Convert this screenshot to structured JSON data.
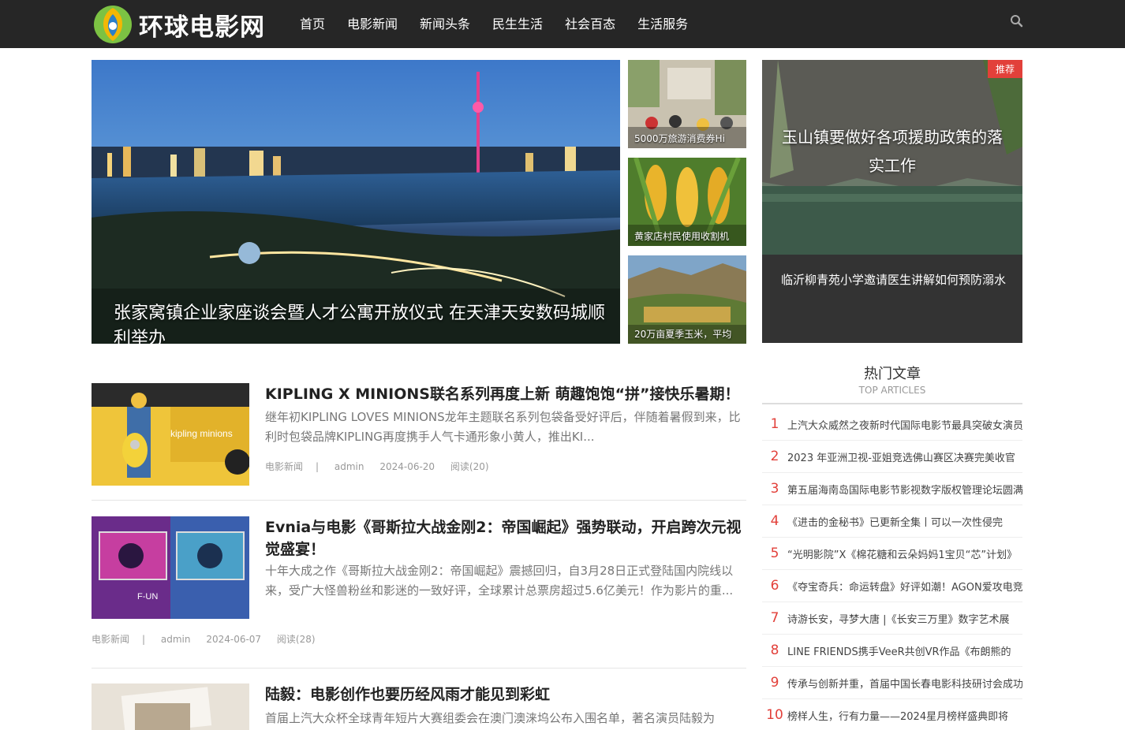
{
  "brand": {
    "name": "环球电影网"
  },
  "nav": [
    "首页",
    "电影新闻",
    "新闻头条",
    "民生生活",
    "社会百态",
    "生活服务"
  ],
  "hero": {
    "main_title": "张家窝镇企业家座谈会暨人才公寓开放仪式 在天津天安数码城顺利举办",
    "thumbs": [
      "5000万旅游消费券Hi",
      "黄家店村民使用收割机",
      "20万亩夏季玉米，平均"
    ],
    "recommend": {
      "badge": "推荐",
      "title": "玉山镇要做好各项援助政策的落实工作",
      "caption": "临沂柳青苑小学邀请医生讲解如何预防溺水"
    }
  },
  "articles": [
    {
      "title": "KIPLING X MINIONS联名系列再度上新 萌趣饱饱“拼”接快乐暑期！",
      "desc": "继年初KIPLING LOVES MINIONS龙年主题联名系列包袋备受好评后，伴随着暑假到来，比利时包袋品牌KIPLING再度携手人气卡通形象小黄人，推出KI...",
      "category": "电影新闻",
      "author": "admin",
      "date": "2024-06-20",
      "views": "阅读(20)"
    },
    {
      "title": "Evnia与电影《哥斯拉大战金刚2：帝国崛起》强势联动，开启跨次元视觉盛宴！",
      "desc": "十年大成之作《哥斯拉大战金刚2：帝国崛起》震撼回归，自3月28日正式登陆国内院线以来，受广大怪兽粉丝和影迷的一致好评，全球累计总票房超过5.6亿美元！作为影片的重...",
      "category": "电影新闻",
      "author": "admin",
      "date": "2024-06-07",
      "views": "阅读(28)"
    },
    {
      "title": "陆毅：电影创作也要历经风雨才能见到彩虹",
      "desc": "首届上汽大众杯全球青年短片大赛组委会在澳门澳涞坞公布入围名单，著名演员陆毅为"
    }
  ],
  "sidebar": {
    "title": "热门文章",
    "subtitle": "TOP ARTICLES",
    "items": [
      {
        "num": "1",
        "text": "上汽大众威然之夜新时代国际电影节最具突破女演员"
      },
      {
        "num": "2",
        "text": "2023 年亚洲卫视-亚姐竞选佛山赛区决赛完美收官"
      },
      {
        "num": "3",
        "text": "第五届海南岛国际电影节影视数字版权管理论坛圆满"
      },
      {
        "num": "4",
        "text": "《进击的金秘书》已更新全集丨可以一次性侵完"
      },
      {
        "num": "5",
        "text": "“光明影院”X《棉花糖和云朵妈妈1宝贝“芯”计划》"
      },
      {
        "num": "6",
        "text": "《夺宝奇兵：命运转盘》好评如潮！AGON爱攻电竞"
      },
      {
        "num": "7",
        "text": "诗游长安，寻梦大唐 |《长安三万里》数字艺术展"
      },
      {
        "num": "8",
        "text": "LINE FRIENDS携手VeeR共创VR作品《布朗熊的"
      },
      {
        "num": "9",
        "text": "传承与创新并重，首届中国长春电影科技研讨会成功"
      },
      {
        "num": "10",
        "text": "榜样人生，行有力量——2024星月榜样盛典即将"
      }
    ]
  },
  "colors": {
    "header_bg": "#262626",
    "accent": "#e2403a"
  }
}
